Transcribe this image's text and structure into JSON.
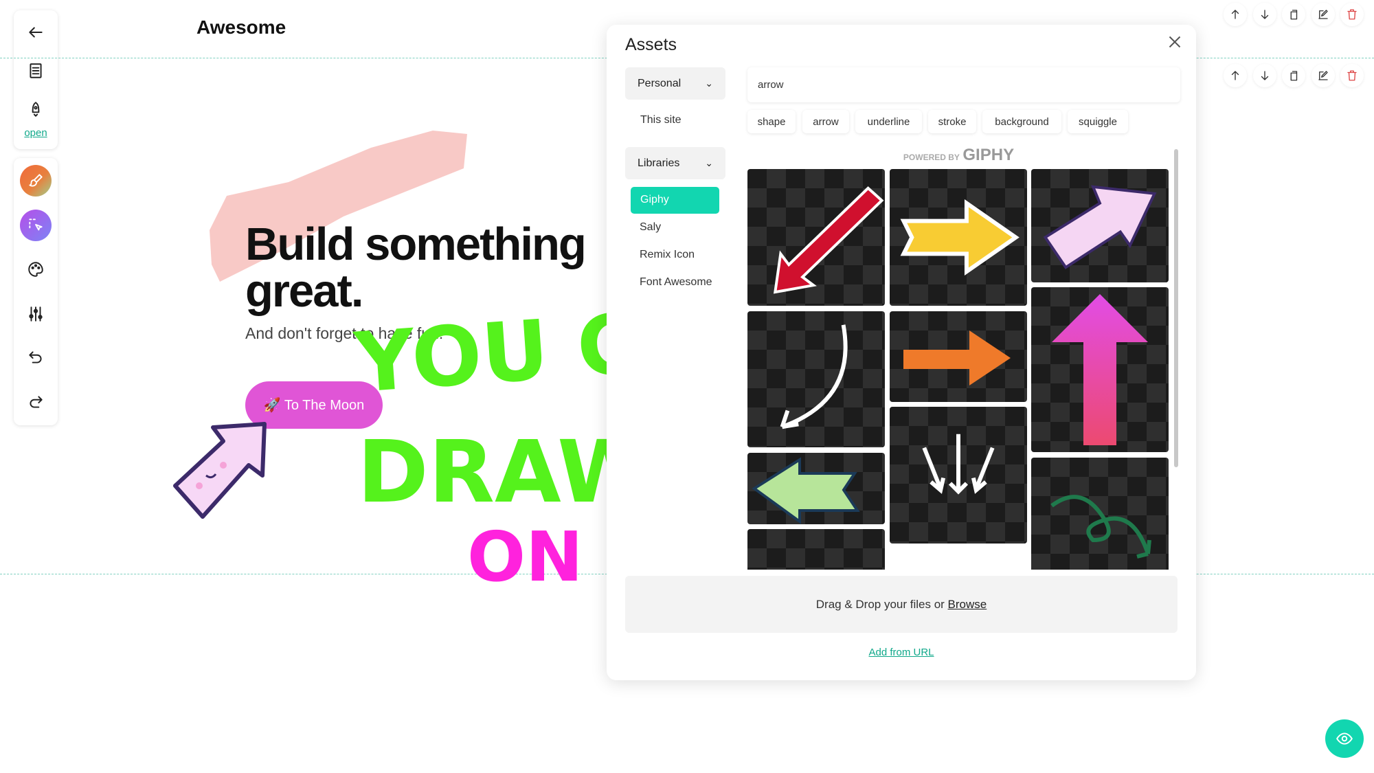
{
  "site": {
    "title": "Awesome"
  },
  "toolbar": {
    "open_label": "open",
    "items": [
      "back-arrow",
      "page",
      "rocket-notify",
      "brush",
      "select",
      "palette",
      "sliders",
      "undo",
      "redo"
    ]
  },
  "hero": {
    "heading_line1": "Build something",
    "heading_line2": "great.",
    "subtitle": "And don't forget to have fun!",
    "button_label": "🚀 To The Moon",
    "button_color": "#e055d6",
    "brush_color": "#f8c9c6"
  },
  "drawing": {
    "line1": "YOU C",
    "line2": "DRAW",
    "line3": "ON",
    "green": "#55f21c",
    "magenta": "#ff22dd"
  },
  "assets": {
    "title": "Assets",
    "personal_label": "Personal",
    "this_site_label": "This site",
    "libraries_label": "Libraries",
    "libraries": [
      {
        "label": "Giphy",
        "active": true
      },
      {
        "label": "Saly"
      },
      {
        "label": "Remix Icon"
      },
      {
        "label": "Font Awesome"
      }
    ],
    "search_value": "arrow",
    "tags": [
      "shape",
      "arrow",
      "underline",
      "stroke",
      "background",
      "squiggle"
    ],
    "powered_by": "POWERED BY",
    "giphy_brand": "GIPHY",
    "dropzone_text": "Drag & Drop your files or ",
    "browse_label": "Browse",
    "add_url_label": "Add from URL",
    "accent": "#12d6b0"
  },
  "row_actions": [
    "move-up",
    "move-down",
    "duplicate",
    "edit",
    "delete"
  ]
}
